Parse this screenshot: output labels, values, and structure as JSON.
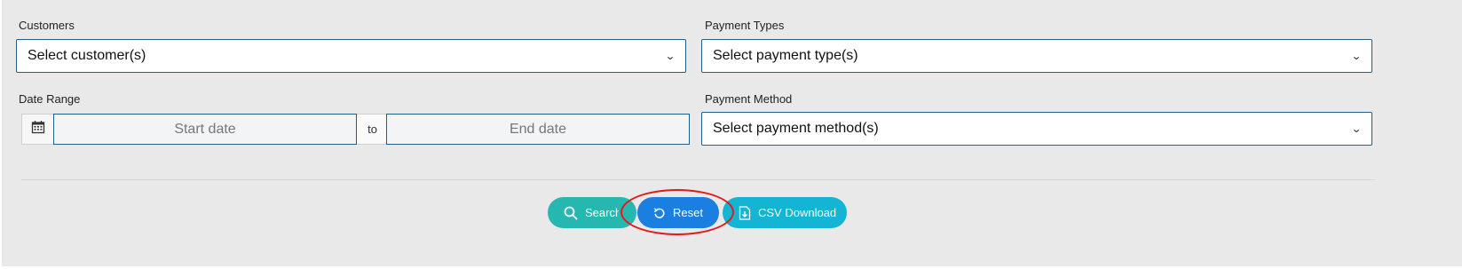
{
  "filters": {
    "customers": {
      "label": "Customers",
      "placeholder": "Select customer(s)"
    },
    "payment_types": {
      "label": "Payment Types",
      "placeholder": "Select payment type(s)"
    },
    "date_range": {
      "label": "Date Range",
      "start_placeholder": "Start date",
      "separator": "to",
      "end_placeholder": "End date"
    },
    "payment_method": {
      "label": "Payment Method",
      "placeholder": "Select payment method(s)"
    }
  },
  "actions": {
    "search_label": "Search",
    "reset_label": "Reset",
    "csv_label": "CSV Download"
  },
  "colors": {
    "panel_bg": "#e9e9e9",
    "field_border": "#1e5f8c",
    "search_btn": "#26b8b0",
    "reset_btn": "#1a7fe0",
    "csv_btn": "#13b4d4",
    "annotation": "#e11b1b"
  },
  "icons": {
    "dropdown": "chevron-down-icon",
    "calendar": "calendar-icon",
    "search": "search-icon",
    "reset": "reset-icon",
    "csv": "csv-download-icon"
  }
}
